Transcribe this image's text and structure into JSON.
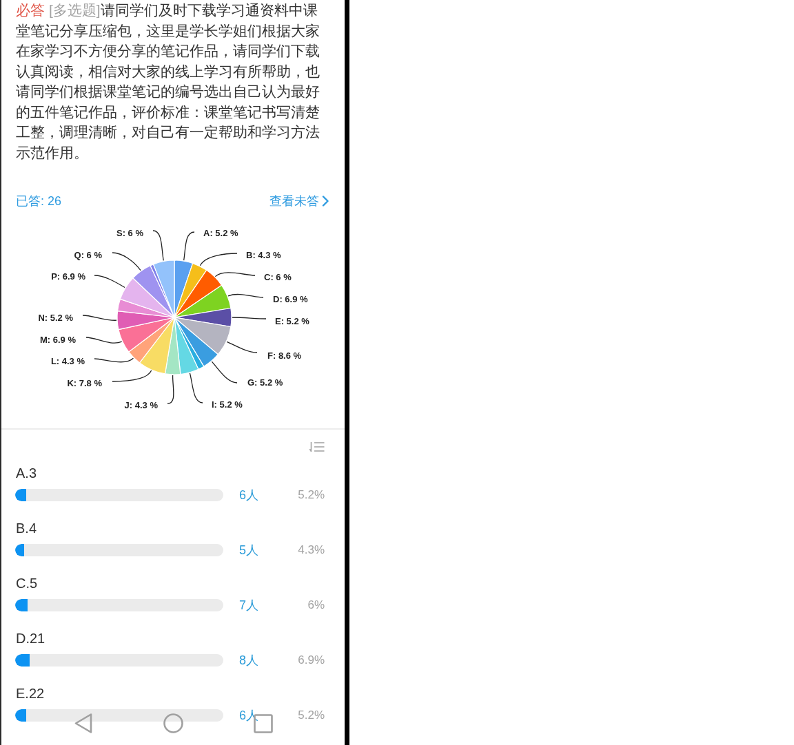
{
  "question": {
    "required_tag": "必答",
    "type_tag": "[多选题]",
    "text": "请同学们及时下载学习通资料中课堂笔记分享压缩包，这里是学长学姐们根据大家在家学习不方便分享的笔记作品，请同学们下载认真阅读，相信对大家的线上学习有所帮助，也请同学们根据课堂笔记的编号选出自己认为最好的五件笔记作品，评价标准：课堂笔记书写清楚工整，调理清晰，对自己有一定帮助和学习方法示范作用。"
  },
  "summary": {
    "answered": "已答: 26",
    "view_unanswered": "查看未答"
  },
  "chart": {
    "chart_data": {
      "type": "pie",
      "categories": [
        "A: 5.2 %",
        "B: 4.3 %",
        "C: 6 %",
        "D: 6.9 %",
        "E: 5.2 %",
        "F: 8.6 %",
        "G: 5.2 %",
        null,
        "I: 5.2 %",
        "J: 4.3 %",
        "K: 7.8 %",
        "L: 4.3 %",
        "M: 6.9 %",
        "N: 5.2 %",
        null,
        "P: 6.9 %",
        "Q: 6 %",
        null,
        "S: 6 %"
      ],
      "values": [
        5.2,
        4.3,
        6,
        6.9,
        5.2,
        8.6,
        5.2,
        1.7,
        5.2,
        4.3,
        7.8,
        4.3,
        6.9,
        5.2,
        3.4,
        6.9,
        6,
        0.9,
        6
      ],
      "colors": [
        "#5aa0f0",
        "#f5be1a",
        "#ff5c00",
        "#7ed321",
        "#5b4fa6",
        "#b4b4c0",
        "#3a9de0",
        "#29aee0",
        "#64d8e4",
        "#a4e6c4",
        "#f8dc64",
        "#ffa37a",
        "#fa7096",
        "#e05db4",
        "#e88cd4",
        "#e4b4ee",
        "#9f93f0",
        "#7f7fe8",
        "#93c2fb"
      ]
    }
  },
  "options": [
    {
      "label": "A.3",
      "level": 0.052,
      "count": "6人",
      "percent": "5.2%"
    },
    {
      "label": "B.4",
      "level": 0.043,
      "count": "5人",
      "percent": "4.3%"
    },
    {
      "label": "C.5",
      "level": 0.06,
      "count": "7人",
      "percent": "6%"
    },
    {
      "label": "D.21",
      "level": 0.069,
      "count": "8人",
      "percent": "6.9%"
    },
    {
      "label": "E.22",
      "level": 0.052,
      "count": "6人",
      "percent": "5.2%"
    }
  ]
}
